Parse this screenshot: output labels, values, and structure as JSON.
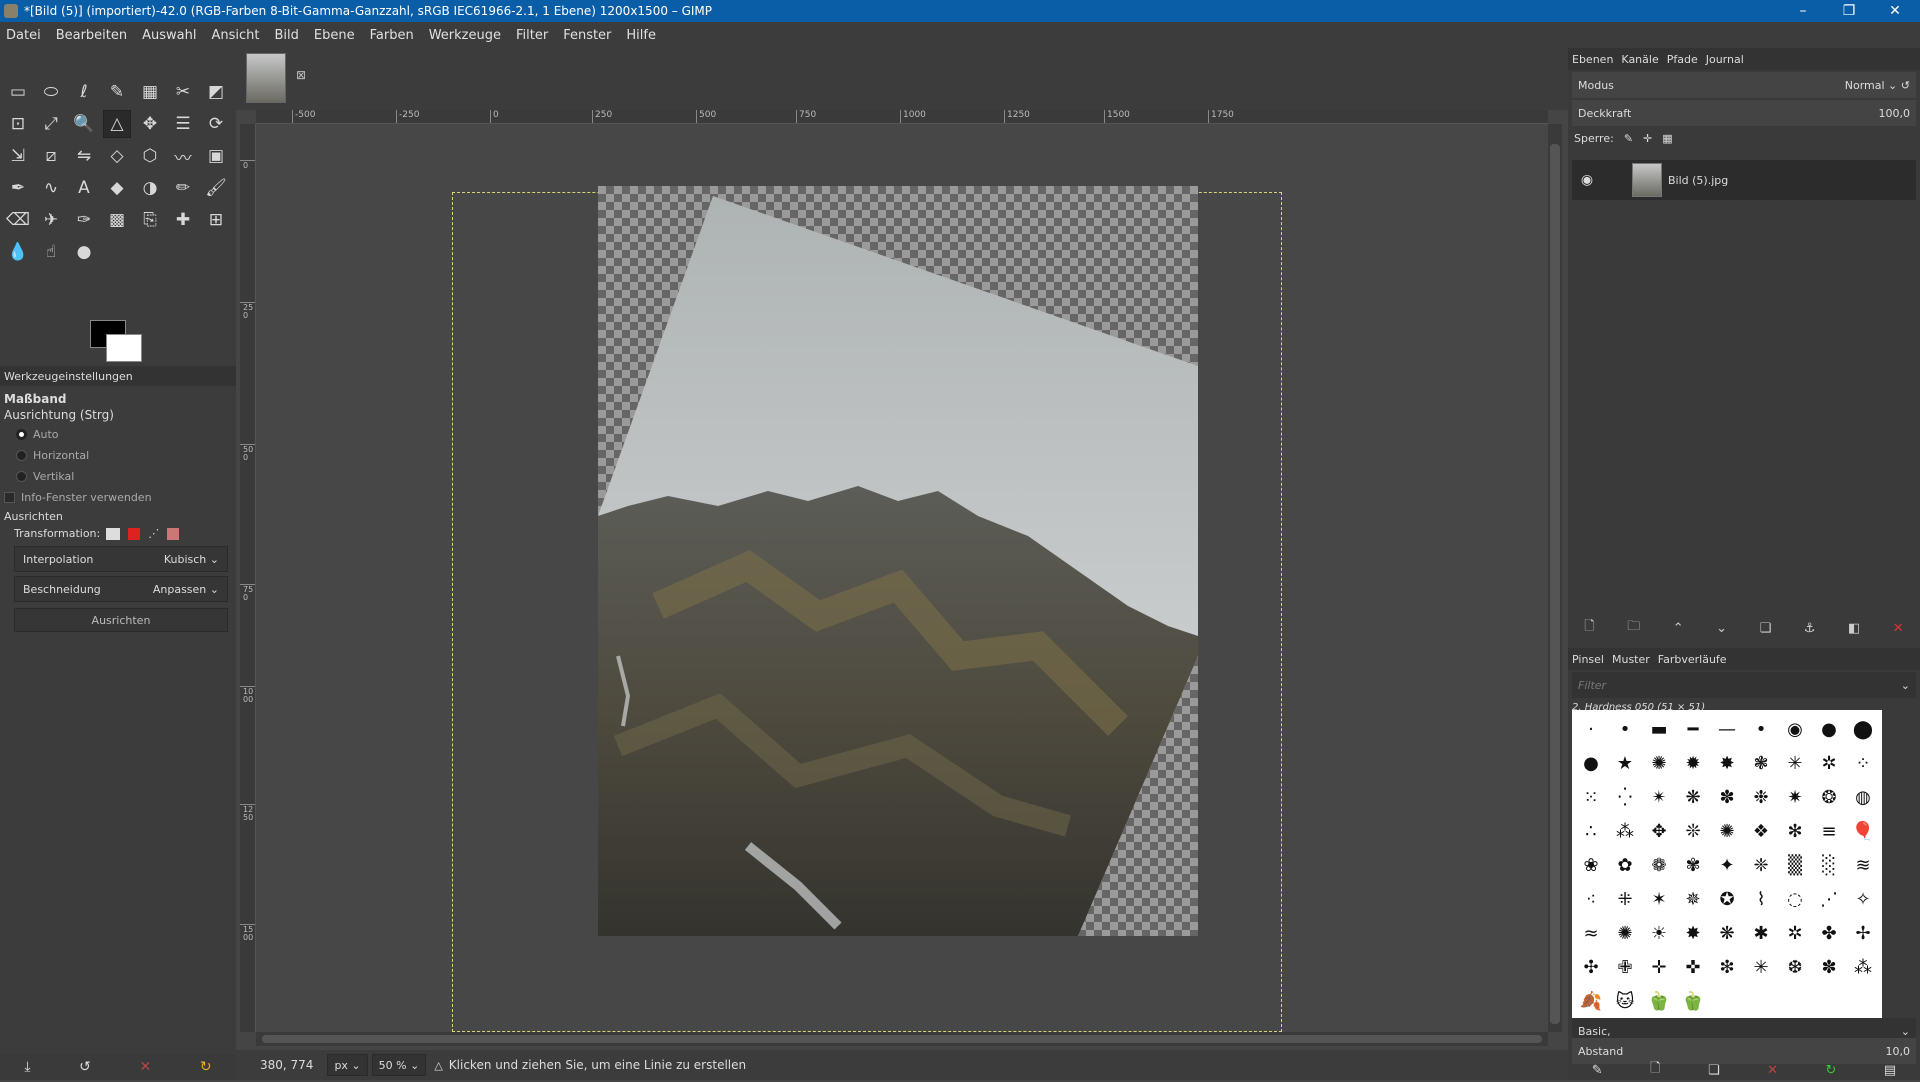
{
  "window": {
    "title": "*[Bild (5)] (importiert)-42.0 (RGB-Farben 8-Bit-Gamma-Ganzzahl, sRGB IEC61966-2.1, 1 Ebene) 1200x1500 – GIMP",
    "controls": [
      "–",
      "❐",
      "✕"
    ]
  },
  "menu": [
    "Datei",
    "Bearbeiten",
    "Auswahl",
    "Ansicht",
    "Bild",
    "Ebene",
    "Farben",
    "Werkzeuge",
    "Filter",
    "Fenster",
    "Hilfe"
  ],
  "tools": [
    {
      "name": "rect-select",
      "glyph": "▭"
    },
    {
      "name": "ellipse-select",
      "glyph": "⬭"
    },
    {
      "name": "free-select",
      "glyph": "ℓ"
    },
    {
      "name": "fuzzy-select",
      "glyph": "✎"
    },
    {
      "name": "color-select",
      "glyph": "▦"
    },
    {
      "name": "scissors",
      "glyph": "✂"
    },
    {
      "name": "foreground-select",
      "glyph": "◩"
    },
    {
      "name": "crop",
      "glyph": "⊡"
    },
    {
      "name": "unified-transform",
      "glyph": "⤢"
    },
    {
      "name": "zoom",
      "glyph": "🔍"
    },
    {
      "name": "measure",
      "glyph": "△",
      "active": true
    },
    {
      "name": "move",
      "glyph": "✥"
    },
    {
      "name": "align",
      "glyph": "☰"
    },
    {
      "name": "rotate",
      "glyph": "⟳"
    },
    {
      "name": "scale",
      "glyph": "⇲"
    },
    {
      "name": "shear",
      "glyph": "⧄"
    },
    {
      "name": "flip",
      "glyph": "⇋"
    },
    {
      "name": "perspective",
      "glyph": "◇"
    },
    {
      "name": "3d-transform",
      "glyph": "⬡"
    },
    {
      "name": "warp",
      "glyph": "〰"
    },
    {
      "name": "cage",
      "glyph": "▣"
    },
    {
      "name": "paths",
      "glyph": "✒"
    },
    {
      "name": "warp-transform",
      "glyph": "∿"
    },
    {
      "name": "text",
      "glyph": "A"
    },
    {
      "name": "bucket-fill",
      "glyph": "◆"
    },
    {
      "name": "gradient",
      "glyph": "◑"
    },
    {
      "name": "pencil",
      "glyph": "✏"
    },
    {
      "name": "paintbrush",
      "glyph": "🖌"
    },
    {
      "name": "eraser",
      "glyph": "⌫"
    },
    {
      "name": "airbrush",
      "glyph": "✈"
    },
    {
      "name": "ink",
      "glyph": "✑"
    },
    {
      "name": "mypaint-brush",
      "glyph": "▩"
    },
    {
      "name": "clone",
      "glyph": "⎘"
    },
    {
      "name": "heal",
      "glyph": "✚"
    },
    {
      "name": "perspective-clone",
      "glyph": "⊞"
    },
    {
      "name": "blur",
      "glyph": "💧"
    },
    {
      "name": "smudge",
      "glyph": "☝"
    },
    {
      "name": "dodge-burn",
      "glyph": "●"
    }
  ],
  "tool_options": {
    "tab_label": "Werkzeugeinstellungen",
    "tool_name": "Maßband",
    "orientation_label": "Ausrichtung (Strg)",
    "orientation_options": [
      "Auto",
      "Horizontal",
      "Vertikal"
    ],
    "selected_orientation": "Auto",
    "info_window_label": "Info-Fenster verwenden",
    "align_section": "Ausrichten",
    "transformation_label": "Transformation:",
    "interpolation_label": "Interpolation",
    "interpolation_value": "Kubisch",
    "clipping_label": "Beschneidung",
    "clipping_value": "Anpassen",
    "align_button": "Ausrichten"
  },
  "rulers": {
    "h_labels": [
      "-500",
      "-250",
      "0",
      "250",
      "500",
      "750",
      "1000",
      "1250",
      "1500",
      "1750"
    ],
    "v_labels": [
      "0",
      "250",
      "500",
      "750",
      "1000",
      "1250",
      "1500"
    ]
  },
  "status": {
    "coords": "380, 774",
    "unit": "px",
    "zoom": "50 %",
    "message": "Klicken und ziehen Sie, um eine Linie zu erstellen"
  },
  "layers_dock": {
    "tabs": [
      "Ebenen",
      "Kanäle",
      "Pfade",
      "Journal"
    ],
    "mode_label": "Modus",
    "mode_value": "Normal",
    "opacity_label": "Deckkraft",
    "opacity_value": "100,0",
    "lock_label": "Sperre:",
    "layer_name": "Bild (5).jpg"
  },
  "brushes_dock": {
    "tabs": [
      "Pinsel",
      "Muster",
      "Farbverläufe"
    ],
    "filter_placeholder": "Filter",
    "selected_brush": "2. Hardness 050 (51 × 51)",
    "preset": "Basic,",
    "spacing_label": "Abstand",
    "spacing_value": "10,0"
  },
  "colors": {
    "accent": "#0a5ea8",
    "guide": "#d6d67a"
  }
}
